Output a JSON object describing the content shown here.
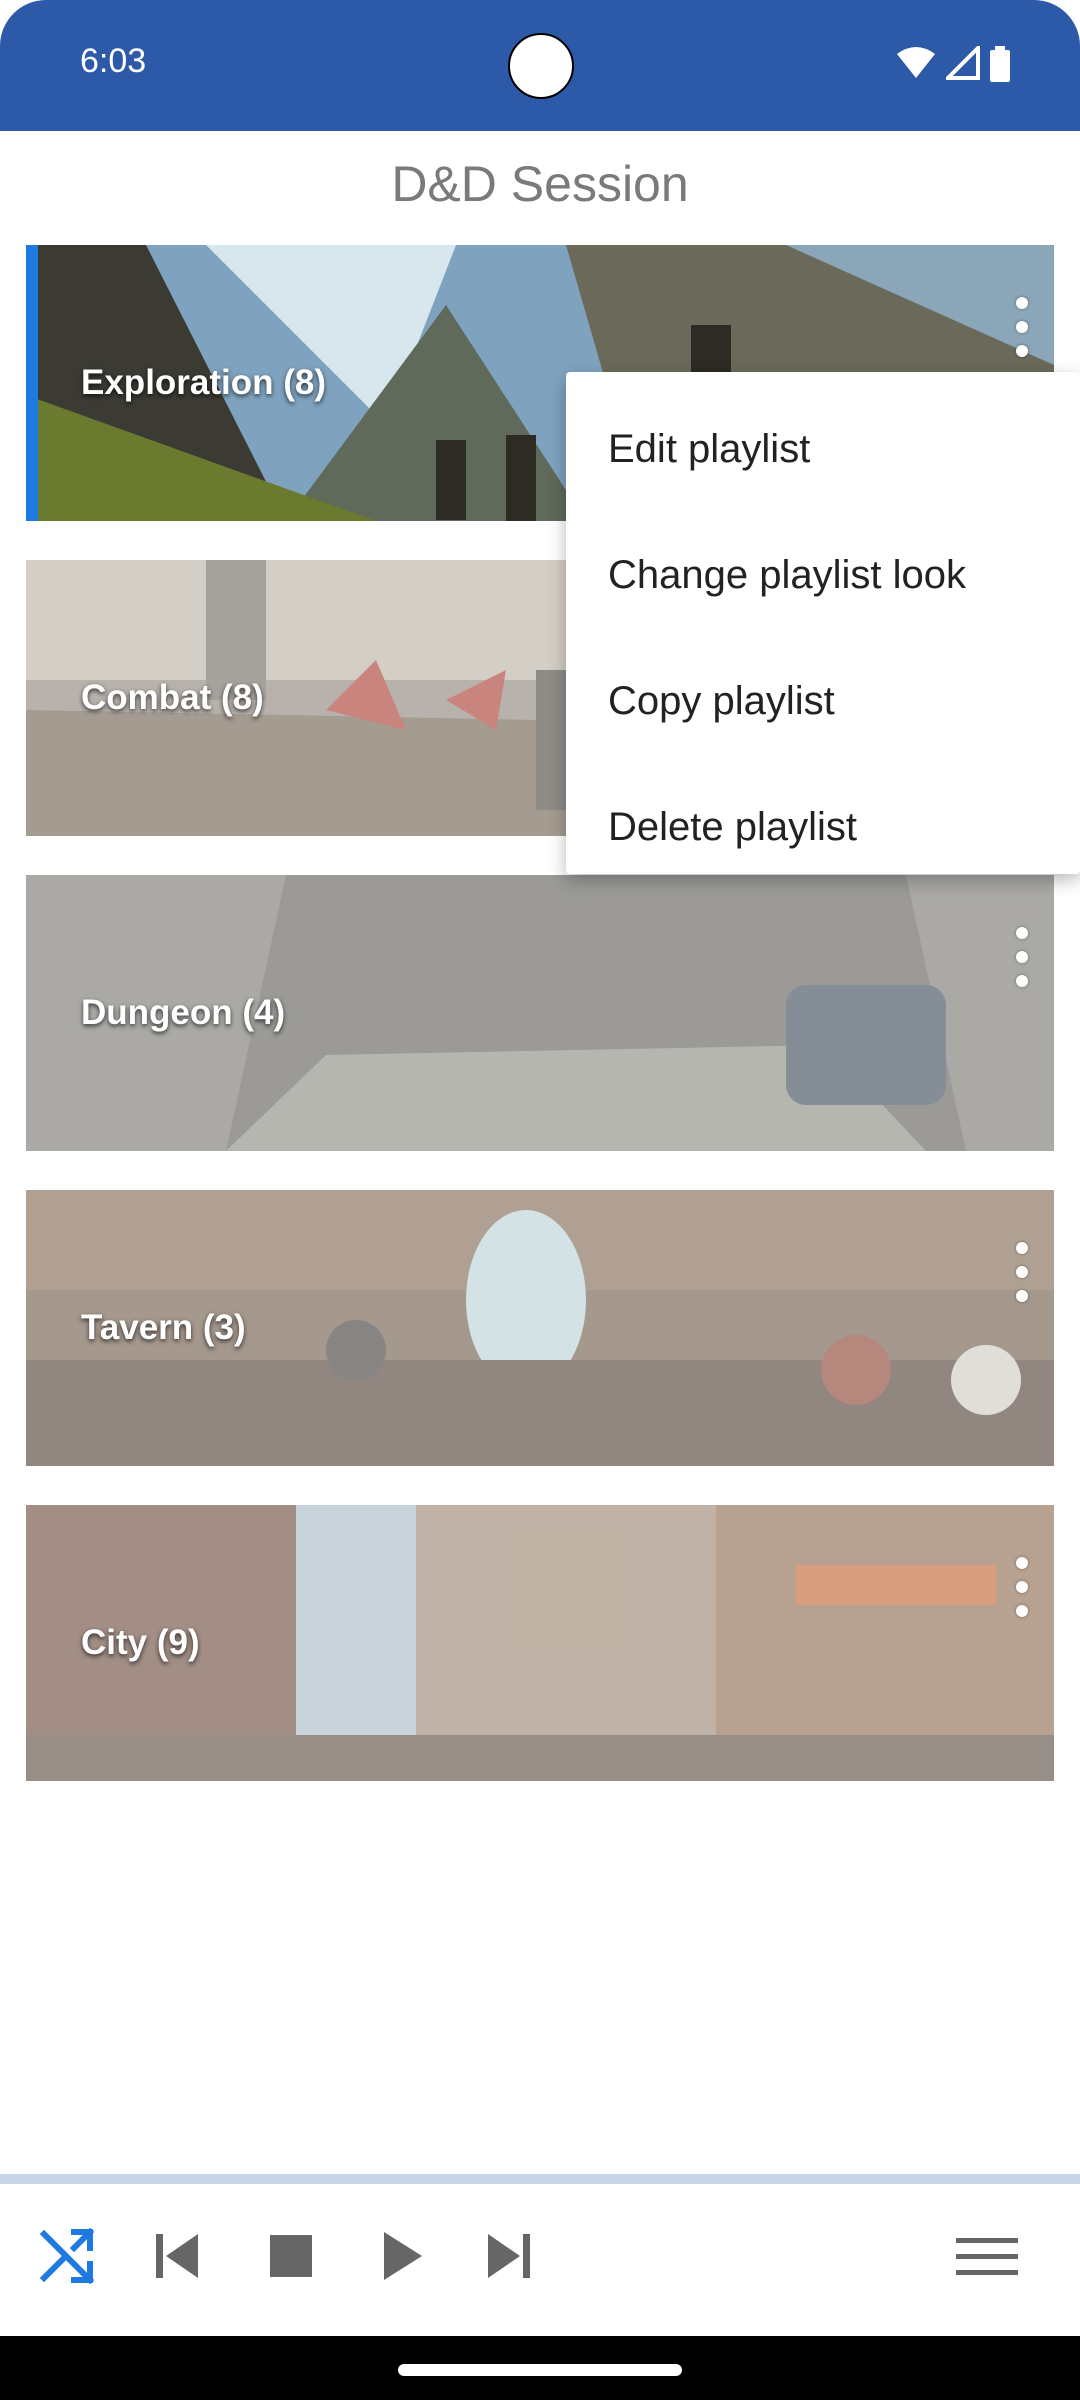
{
  "status_bar": {
    "time": "6:03",
    "icons": [
      "wifi-icon",
      "signal-icon",
      "battery-icon"
    ],
    "background": "#2c5aa8"
  },
  "title": "D&D Session",
  "playlists": [
    {
      "label": "Exploration (8)",
      "selected": true
    },
    {
      "label": "Combat (8)",
      "selected": false
    },
    {
      "label": "Dungeon (4)",
      "selected": false
    },
    {
      "label": "Tavern (3)",
      "selected": false
    },
    {
      "label": "City (9)",
      "selected": false
    }
  ],
  "context_menu": {
    "items": [
      "Edit playlist",
      "Change playlist look",
      "Copy playlist",
      "Delete playlist"
    ]
  },
  "player": {
    "controls": [
      "shuffle-icon",
      "previous-icon",
      "stop-icon",
      "play-icon",
      "next-icon",
      "menu-icon"
    ],
    "shuffle_color": "#1e7ae0",
    "control_color": "#666666"
  },
  "accent": "#1e7ae0"
}
